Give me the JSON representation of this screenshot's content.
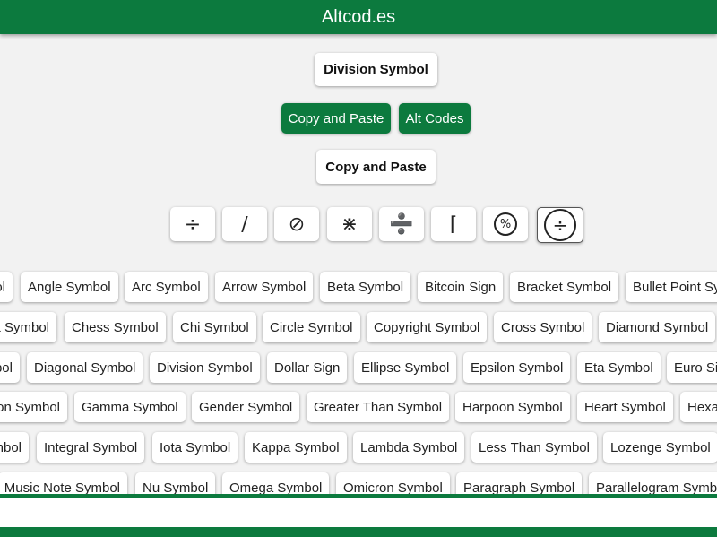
{
  "header": {
    "title": "Altcod.es"
  },
  "main": {
    "title_button": "Division Symbol",
    "copy_paste_button": "Copy and Paste",
    "alt_codes_button": "Alt Codes",
    "section_button": "Copy and Paste"
  },
  "symbols": [
    "÷",
    "∕",
    "⊘",
    "⋇",
    "➗",
    "⌈",
    "%",
    "÷"
  ],
  "chips": {
    "row0": [
      "ol",
      "Angle Symbol",
      "Arc Symbol",
      "Arrow Symbol",
      "Beta Symbol",
      "Bitcoin Sign",
      "Bracket Symbol",
      "Bullet Point Sy"
    ],
    "row1": [
      "t Symbol",
      "Chess Symbol",
      "Chi Symbol",
      "Circle Symbol",
      "Copyright Symbol",
      "Cross Symbol",
      "Diamond Symbol"
    ],
    "row2": [
      "bol",
      "Diagonal Symbol",
      "Division Symbol",
      "Dollar Sign",
      "Ellipse Symbol",
      "Epsilon Symbol",
      "Eta Symbol",
      "Euro Si"
    ],
    "row3": [
      "on Symbol",
      "Gamma Symbol",
      "Gender Symbol",
      "Greater Than Symbol",
      "Harpoon Symbol",
      "Heart Symbol",
      "Hexa"
    ],
    "row4": [
      "nbol",
      "Integral Symbol",
      "Iota Symbol",
      "Kappa Symbol",
      "Lambda Symbol",
      "Less Than Symbol",
      "Lozenge Symbol"
    ],
    "row5": [
      "Music Note Symbol",
      "Nu Symbol",
      "Omega Symbol",
      "Omicron Symbol",
      "Paragraph Symbol",
      "Parallelogram Symb"
    ]
  },
  "colors": {
    "brand_green": "#0c7a3e",
    "background": "#f2f2f2"
  }
}
